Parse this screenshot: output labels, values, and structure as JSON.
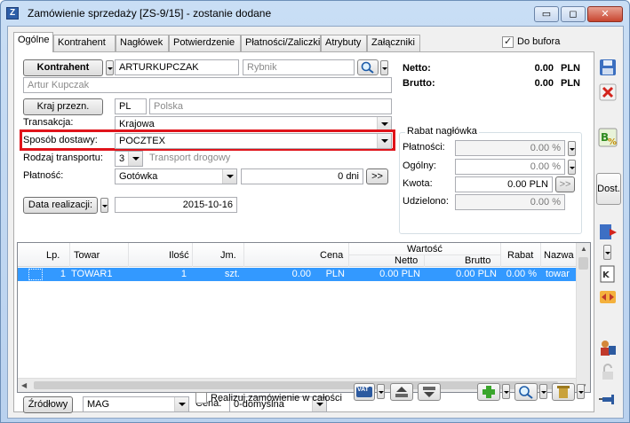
{
  "window": {
    "title": "Zamówienie sprzedaży [ZS-9/15] - zostanie dodane",
    "app_icon_letter": "Z",
    "buttons": {
      "minimize": "▭",
      "maximize": "◻",
      "close": "✕"
    }
  },
  "tabs": [
    "Ogólne",
    "Kontrahent",
    "Nagłówek",
    "Potwierdzenie",
    "Płatności/Zaliczki",
    "Atrybuty",
    "Załączniki"
  ],
  "active_tab": "Ogólne",
  "do_bufora": {
    "label": "Do bufora",
    "checked": true
  },
  "kontrahent": {
    "button": "Kontrahent",
    "code": "ARTURKUPCZAK",
    "city_placeholder": "Rybnik",
    "name": "Artur Kupczak"
  },
  "kraj": {
    "button": "Kraj przezn.",
    "code": "PL",
    "name": "Polska"
  },
  "fields": {
    "transakcja_label": "Transakcja:",
    "transakcja_value": "Krajowa",
    "sposob_label": "Sposób dostawy:",
    "sposob_value": "POCZTEX",
    "rodzaj_label": "Rodzaj transportu:",
    "rodzaj_value": "3",
    "rodzaj_desc": "Transport drogowy",
    "platnosc_label": "Płatność:",
    "platnosc_value": "Gotówka",
    "dni_value": "0 dni",
    "dni_button": ">>",
    "data_button": "Data realizacji:",
    "data_value": "2015-10-16"
  },
  "totals": {
    "netto_label": "Netto:",
    "netto_value": "0.00",
    "brutto_label": "Brutto:",
    "brutto_value": "0.00",
    "currency": "PLN"
  },
  "rabat": {
    "title": "Rabat nagłówka",
    "platnosci_label": "Płatności:",
    "platnosci_value": "0.00 %",
    "ogolny_label": "Ogólny:",
    "ogolny_value": "0.00 %",
    "kwota_label": "Kwota:",
    "kwota_value": "0.00 PLN",
    "kwota_button": ">>",
    "udzielono_label": "Udzielono:",
    "udzielono_value": "0.00 %"
  },
  "table": {
    "headers": {
      "lp": "Lp.",
      "towar": "Towar",
      "ilosc": "Ilość",
      "jm": "Jm.",
      "cena": "Cena",
      "wartosc": "Wartość",
      "netto": "Netto",
      "brutto": "Brutto",
      "rabat": "Rabat",
      "nazwa": "Nazwa"
    },
    "rows": [
      {
        "lp": "1",
        "towar": "TOWAR1",
        "ilosc": "1",
        "jm": "szt.",
        "cena": "0.00",
        "cena_cur": "PLN",
        "netto": "0.00 PLN",
        "brutto": "0.00 PLN",
        "rabat": "0.00 %",
        "nazwa": "towar"
      }
    ]
  },
  "bottom": {
    "zrodlowy_button": "Źródłowy",
    "magazyn_value": "MAG",
    "cena_label": "Cena:",
    "cena_value": "0-domyślna",
    "realizuj_label": "Realizuj zamówienie w całości",
    "vat_label": "VAT"
  },
  "side": {
    "dost_label": "Dost."
  }
}
